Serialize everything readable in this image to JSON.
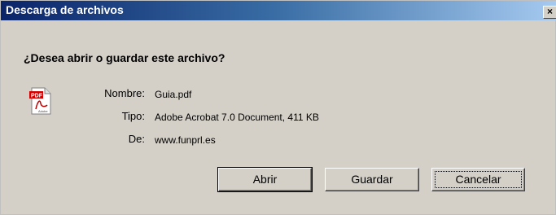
{
  "window": {
    "title": "Descarga de archivos",
    "close_glyph": "×"
  },
  "dialog": {
    "question": "¿Desea abrir o guardar este archivo?",
    "file_icon": "pdf-adobe-icon",
    "fields": {
      "name_label": "Nombre:",
      "name_value": "Guia.pdf",
      "type_label": "Tipo:",
      "type_value": "Adobe Acrobat 7.0 Document, 411 KB",
      "from_label": "De:",
      "from_value": "www.funprl.es"
    }
  },
  "buttons": {
    "open": "Abrir",
    "save": "Guardar",
    "cancel": "Cancelar"
  },
  "colors": {
    "title_bar_start": "#0a246a",
    "title_bar_end": "#a6caf0",
    "dialog_bg": "#d4d0c8"
  }
}
